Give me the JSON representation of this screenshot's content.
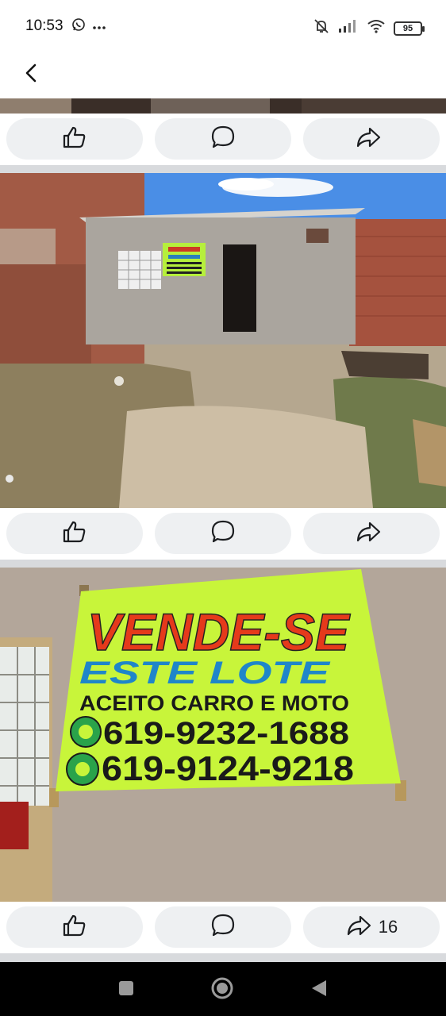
{
  "status_bar": {
    "time": "10:53",
    "battery": "95",
    "left_icons": [
      "whatsapp-icon",
      "more-icon"
    ],
    "right_icons": [
      "mute-icon",
      "signal-icon",
      "wifi-icon",
      "battery-icon"
    ]
  },
  "header": {
    "back_icon": "back-chevron-icon"
  },
  "posts": [
    {
      "actions": [
        "like-icon",
        "comment-icon",
        "share-icon"
      ],
      "share_count": ""
    },
    {
      "photo": "small concrete house on a dirt lot with a green for-sale sign",
      "actions": [
        "like-icon",
        "comment-icon",
        "share-icon"
      ],
      "share_count": ""
    },
    {
      "photo": "large neon green for-sale banner on a concrete wall",
      "sign": {
        "line1": "VENDE-SE",
        "line2": "ESTE LOTE",
        "line3": "ACEITO CARRO E MOTO",
        "phone1": "619-9232-1688",
        "phone2": "619-9124-9218"
      },
      "actions": [
        "like-icon",
        "comment-icon",
        "share-icon"
      ],
      "share_count": "16"
    }
  ],
  "colors": {
    "action_bg": "#eef0f2",
    "separator": "#d8dadd",
    "sign_green": "#c8f53a",
    "sign_red": "#e53a1b",
    "sign_blue": "#1f86c9"
  },
  "nav_bar": {
    "buttons": [
      "recents-square-icon",
      "home-circle-icon",
      "back-triangle-icon"
    ]
  }
}
